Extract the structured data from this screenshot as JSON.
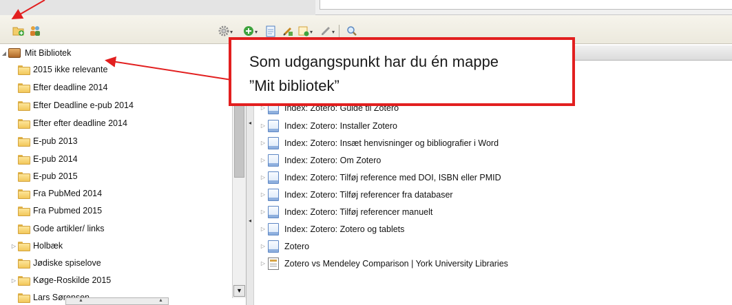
{
  "colors": {
    "callout_border": "#e21f1f",
    "arrow": "#e21f1f",
    "folder": "#f2c75a"
  },
  "toolbar": {
    "icons": [
      "new-collection-icon",
      "new-group-icon",
      "actions-gear-icon",
      "new-item-icon",
      "new-note-icon",
      "add-attachment-icon",
      "add-by-identifier-icon",
      "annotation-pen-icon",
      "search-icon"
    ]
  },
  "library": {
    "root_label": "Mit Bibliotek",
    "collections": [
      {
        "label": "2015 ikke relevante",
        "expandable": false
      },
      {
        "label": "Efter deadline 2014",
        "expandable": false
      },
      {
        "label": "Efter Deadline e-pub 2014",
        "expandable": false
      },
      {
        "label": "Efter efter deadline 2014",
        "expandable": false
      },
      {
        "label": "E-pub 2013",
        "expandable": false
      },
      {
        "label": "E-pub 2014",
        "expandable": false
      },
      {
        "label": "E-pub 2015",
        "expandable": false
      },
      {
        "label": "Fra PubMed 2014",
        "expandable": false
      },
      {
        "label": "Fra Pubmed 2015",
        "expandable": false
      },
      {
        "label": "Gode artikler/ links",
        "expandable": false
      },
      {
        "label": "Holbæk",
        "expandable": true
      },
      {
        "label": "Jødiske spiselove",
        "expandable": false
      },
      {
        "label": "Køge-Roskilde 2015",
        "expandable": true
      },
      {
        "label": "Lars Sørensen",
        "expandable": false
      }
    ]
  },
  "items": [
    {
      "title": "Index: Zotero: Guide til Zotero",
      "icon": "document-icon"
    },
    {
      "title": "Index: Zotero: Installer Zotero",
      "icon": "document-icon"
    },
    {
      "title": "Index: Zotero: Insæt henvisninger og bibliografier i Word",
      "icon": "document-icon"
    },
    {
      "title": "Index: Zotero: Om Zotero",
      "icon": "document-icon"
    },
    {
      "title": "Index: Zotero: Tilføj reference med DOI, ISBN eller PMID",
      "icon": "document-icon"
    },
    {
      "title": "Index: Zotero: Tilføj referencer fra databaser",
      "icon": "document-icon"
    },
    {
      "title": "Index: Zotero: Tilføj referencer manuelt",
      "icon": "document-icon"
    },
    {
      "title": "Index: Zotero: Zotero og tablets",
      "icon": "document-icon"
    },
    {
      "title": "Zotero",
      "icon": "document-icon"
    },
    {
      "title": "Zotero vs Mendeley Comparison | York University Libraries",
      "icon": "webpage-icon"
    }
  ],
  "callout": {
    "line1": "Som udgangspunkt har du én mappe",
    "line2": "”Mit bibliotek”"
  }
}
